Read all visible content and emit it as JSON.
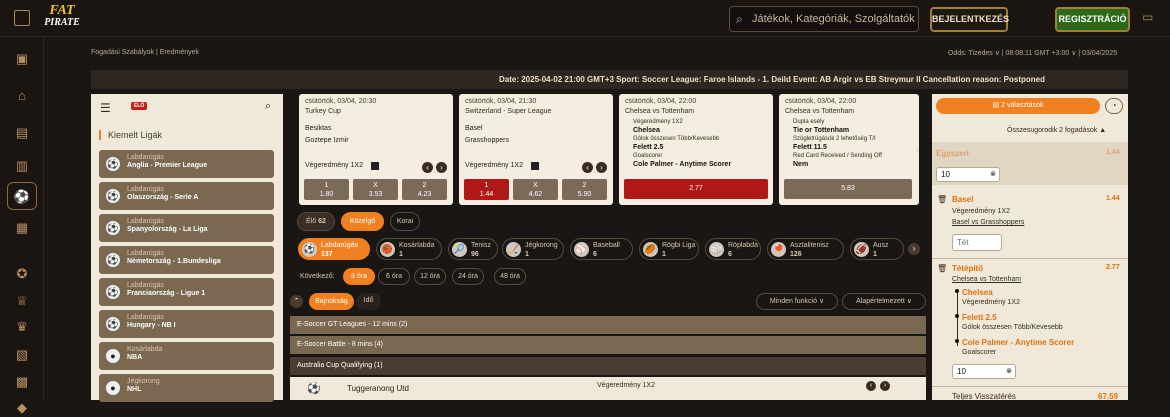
{
  "logo": {
    "line1": "FAT",
    "line2": "PIRATE"
  },
  "search": {
    "placeholder": "Játékok, Kategóriák, Szolgáltatók"
  },
  "auth": {
    "login": "BEJELENTKEZÉS",
    "register": "REGISZTRÁCIÓ"
  },
  "crumb": "Fogadási Szabályok | Eredmények",
  "oddsbar": "Odds: Tizedes ∨ | 08:08:11 GMT +3:00 ∨ | 03/04/2025",
  "ticker": "Date: 2025-04-02 21:00 GMT+3 Sport: Soccer League: Faroe Islands - 1. Deild Event: AB Argir vs EB Streymur II Cancellation reason: Postponed",
  "sportpanel": {
    "live": "ÉLŐ",
    "featured": "Kiemelt Ligák",
    "leagues": [
      {
        "sport": "Labdarúgás",
        "league": "Anglia - Premier League"
      },
      {
        "sport": "Labdarúgás",
        "league": "Olaszország - Serie A"
      },
      {
        "sport": "Labdarúgás",
        "league": "Spanyolország - La Liga"
      },
      {
        "sport": "Labdarúgás",
        "league": "Németország - 1.Bundesliga"
      },
      {
        "sport": "Labdarúgás",
        "league": "Franciaország - Ligue 1"
      },
      {
        "sport": "Labdarúgás",
        "league": "Hungary - NB I"
      },
      {
        "sport": "Kosárlabda",
        "league": "NBA"
      },
      {
        "sport": "Jégkorong",
        "league": "NHL"
      }
    ]
  },
  "cards": [
    {
      "date": "csütörtök, 03/04, 20:30",
      "league": "Turkey Cup",
      "team1": "Besiktas",
      "team2": "Goztepe Izmir",
      "market": "Végeredmény 1X2",
      "odds": [
        {
          "l": "1",
          "v": "1.80"
        },
        {
          "l": "X",
          "v": "3.53"
        },
        {
          "l": "2",
          "v": "4.23"
        }
      ]
    },
    {
      "date": "csütörtök, 03/04, 21:30",
      "league": "Switzerland - Super League",
      "team1": "Basel",
      "team2": "Grasshoppers",
      "market": "Végeredmény 1X2",
      "odds": [
        {
          "l": "1",
          "v": "1.44"
        },
        {
          "l": "X",
          "v": "4.62"
        },
        {
          "l": "2",
          "v": "5.90"
        }
      ]
    },
    {
      "date": "csütörtök, 03/04, 22:00",
      "league": "Chelsea vs Tottenham",
      "l1": "Végeredmény 1X2",
      "b1": "Chelsea",
      "l2": "Gólok összesen Több/Kevesebb",
      "b2": "Felett 2.5",
      "l3": "Goalscorer",
      "b3": "Cole Palmer - Anytime Scorer",
      "price": "2.77"
    },
    {
      "date": "csütörtök, 03/04, 22:00",
      "league": "Chelsea vs Tottenham",
      "l1": "Dupla esély",
      "b1": "Tie or Tottenham",
      "l2": "Szögletrúgások 2 lehetőség T/I",
      "b2": "Felett 11.5",
      "l3": "Red Card Received / Sending Off",
      "b3": "Nem",
      "price": "5.83"
    }
  ],
  "filters": {
    "live": "Élő",
    "live_count": "62",
    "upcoming": "Közelgő",
    "early": "Korai"
  },
  "sports": [
    {
      "name": "Labdarúgás",
      "count": "137",
      "icon": "⚽"
    },
    {
      "name": "Kosárlabda",
      "count": "1",
      "icon": "🏀"
    },
    {
      "name": "Tenisz",
      "count": "96",
      "icon": "🎾"
    },
    {
      "name": "Jégkorong",
      "count": "1",
      "icon": "🏒"
    },
    {
      "name": "Baseball",
      "count": "6",
      "icon": "⚾"
    },
    {
      "name": "Rögbi Liga",
      "count": "1",
      "icon": "🏉"
    },
    {
      "name": "Röplabda",
      "count": "6",
      "icon": "🏐"
    },
    {
      "name": "Asztalitenisz",
      "count": "126",
      "icon": "🏓"
    },
    {
      "name": "Ausz",
      "count": "1",
      "icon": "🏈"
    }
  ],
  "next": {
    "label": "Következő:",
    "options": [
      "3 óra",
      "6 óra",
      "12 óra",
      "24 óra",
      "48 óra"
    ]
  },
  "sort": {
    "a": "Bajnokság",
    "b": "Idő",
    "functions": "Minden funkció ∨",
    "default": "Alapértelmezett ∨"
  },
  "leaguerows": [
    "E-Soccer GT Leagues - 12 mins (2)",
    "E-Soccer Battle - 8 mins (4)",
    "Australia Cup Qualifying (1)"
  ],
  "fixture": {
    "team": "Tuggeranong Utd",
    "market": "Végeredmény 1X2"
  },
  "betslip": {
    "selections": "2 választások",
    "collapse": "Összesugorodik 2 fogadások ▲",
    "single": "Egyszeri",
    "single_odds": "1.44",
    "stake1": "10",
    "leg": {
      "name": "Basel",
      "odds": "1.44",
      "market": "Végeredmény 1X2",
      "event": "Basel vs Grasshoppers",
      "stake_ph": "Tét"
    },
    "bb": {
      "name": "Tétépítő",
      "odds": "2.77",
      "event": "Chelsea vs Tottenham",
      "sel": [
        {
          "n": "Chelsea",
          "m": "Végeredmény 1X2"
        },
        {
          "n": "Felett 2.5",
          "m": "Gólok összesen Több/Kevesebb"
        },
        {
          "n": "Cole Palmer - Anytime Scorer",
          "m": "Goalscorer"
        }
      ]
    },
    "stake2": "10",
    "total": "Teljes Visszatérés",
    "total_val": "67.59"
  }
}
